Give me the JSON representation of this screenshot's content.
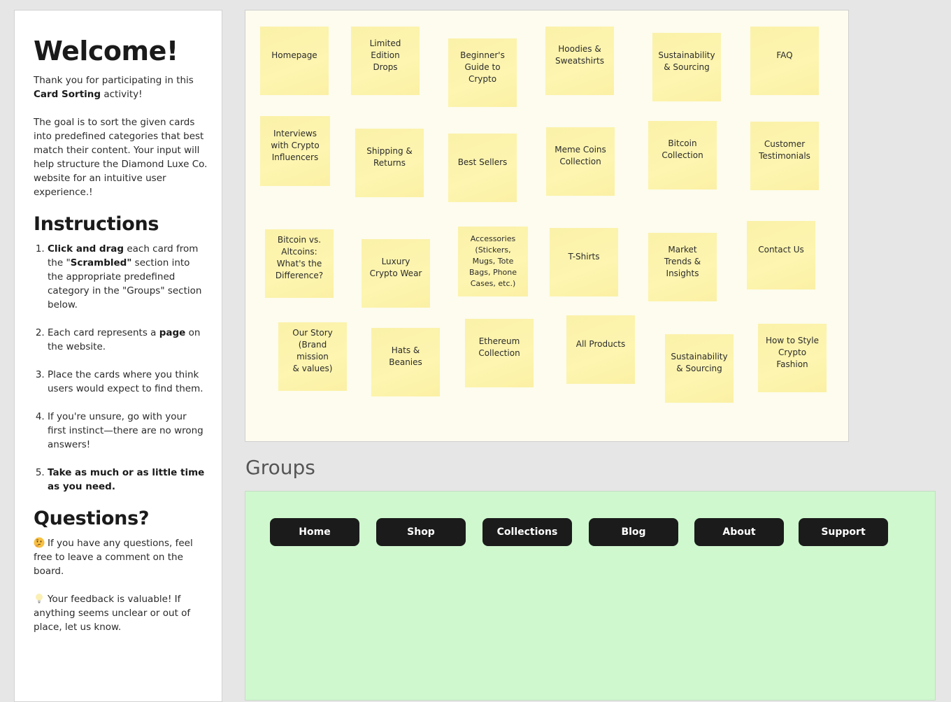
{
  "sidebar": {
    "welcome_title": "Welcome!",
    "intro_text_before": "Thank you for participating in this ",
    "intro_bold": "Card Sorting",
    "intro_text_after": " activity!",
    "goal_text": "The goal is to sort the given cards into predefined categories that best match their content. Your input will help structure the Diamond Luxe Co. website for an intuitive user experience.!",
    "instructions_title": "Instructions",
    "instructions": [
      {
        "bold_lead": "Click and drag",
        "text_1": " each card from the \"",
        "bold_mid": "Scrambled\"",
        "text_2": " section into the appropriate predefined category in the \"Groups\" section below."
      },
      {
        "text_1": "Each card represents a ",
        "bold_mid": "page",
        "text_2": " on the website."
      },
      {
        "text_1": "Place the cards where you think users would expect to find them."
      },
      {
        "text_1": "If you're unsure, go with your first instinct—there are no wrong answers!"
      },
      {
        "bold_lead": "Take as much or as little time as you need."
      }
    ],
    "questions_title": "Questions?",
    "questions": [
      {
        "icon": "thinking-face-emoji",
        "text": "If you have any questions, feel free to leave a comment on the board."
      },
      {
        "icon": "light-bulb-emoji",
        "text": "Your feedback is valuable! If anything seems unclear or out of place, let us know."
      }
    ]
  },
  "scrambled": {
    "cards": [
      "Homepage",
      "Limited Edition Drops",
      "Beginner's Guide to Crypto",
      "Hoodies & Sweatshirts",
      "Sustainability & Sourcing",
      "FAQ",
      "Interviews with Crypto Influencers",
      "Shipping & Returns",
      "Best Sellers",
      "Meme Coins Collection",
      "Bitcoin Collection",
      "Customer Testimonials",
      "Bitcoin vs. Altcoins: What's the Difference?",
      "Luxury Crypto Wear",
      "Accessories (Stickers, Mugs, Tote Bags, Phone Cases, etc.)",
      "T-Shirts",
      "Market Trends & Insights",
      "Contact Us",
      "Our Story (Brand mission & values)",
      "Hats & Beanies",
      "Ethereum Collection",
      "All Products",
      "Sustainability & Sourcing",
      "How to Style Crypto Fashion"
    ],
    "card_color": "#fdf4a8"
  },
  "groups": {
    "title": "Groups",
    "categories": [
      "Home",
      "Shop",
      "Collections",
      "Blog",
      "About",
      "Support"
    ],
    "board_color": "#cff8cf",
    "button_color": "#1b1b1b"
  }
}
